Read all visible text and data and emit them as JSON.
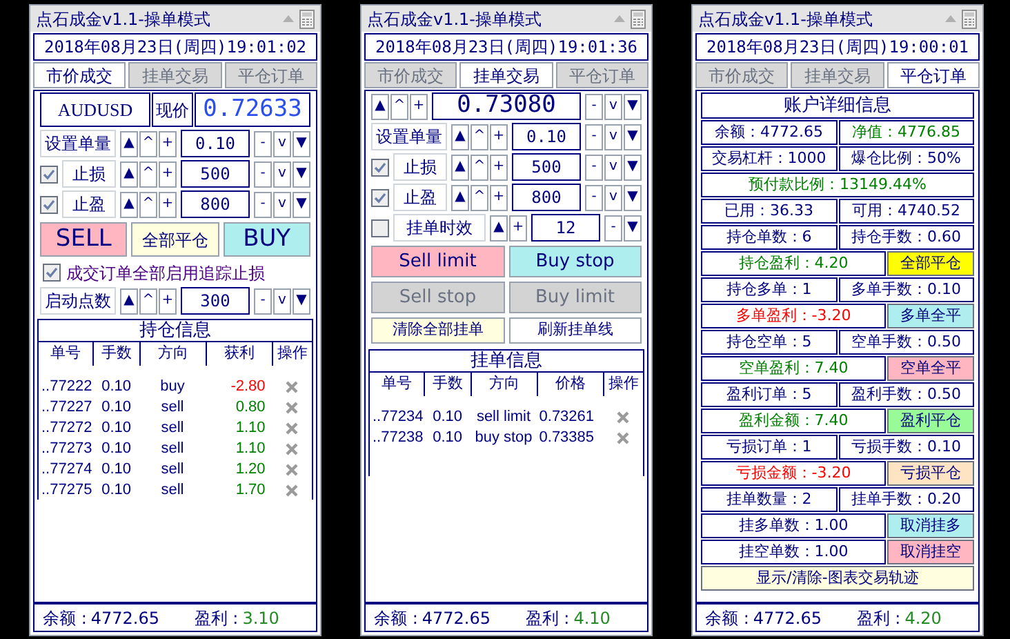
{
  "panels": [
    {
      "title": "点石成金v1.1-操单模式",
      "datetime": "2018年08月23日(周四)19:01:02",
      "tabs": [
        {
          "label": "市价成交",
          "selected": true
        },
        {
          "label": "挂单交易",
          "selected": false
        },
        {
          "label": "平仓订单",
          "selected": false
        }
      ],
      "sections": [
        {
          "kind": "quote",
          "symbol": "AUDUSD",
          "label": "现价",
          "price": "0.72633"
        },
        {
          "kind": "stepper",
          "label": "设置单量",
          "value": "0.10",
          "up": [
            "▲",
            "^",
            "+"
          ],
          "down": [
            "-",
            "v",
            "▼"
          ]
        },
        {
          "kind": "stepper",
          "label": "止损",
          "checked": true,
          "value": "500",
          "up": [
            "▲",
            "^",
            "+"
          ],
          "down": [
            "-",
            "v",
            "▼"
          ]
        },
        {
          "kind": "stepper",
          "label": "止盈",
          "checked": true,
          "value": "800",
          "up": [
            "▲",
            "^",
            "+"
          ],
          "down": [
            "-",
            "v",
            "▼"
          ]
        },
        {
          "kind": "buttons",
          "items": [
            {
              "label": "SELL",
              "color": "#ffb6c1",
              "disabled": false
            },
            {
              "label": "全部平仓",
              "color": "#ffffe0",
              "disabled": false
            },
            {
              "label": "BUY",
              "color": "#afeeee",
              "disabled": false
            }
          ]
        },
        {
          "kind": "checkbox",
          "label": "成交订单全部启用追踪止损",
          "checked": true
        },
        {
          "kind": "stepper",
          "label": "启动点数",
          "value": "300",
          "up": [
            "▲",
            "^",
            "+"
          ],
          "down": [
            "-",
            "v",
            "▼"
          ]
        },
        {
          "kind": "table",
          "title": "持仓信息",
          "columns": [
            "单号",
            "手数",
            "方向",
            "获利",
            "操作"
          ],
          "rows": [
            {
              "cells": [
                "..77222",
                "0.10",
                "buy",
                "-2.80"
              ],
              "color": "#ff0000"
            },
            {
              "cells": [
                "..77227",
                "0.10",
                "sell",
                "0.80"
              ],
              "color": "#008000"
            },
            {
              "cells": [
                "..77272",
                "0.10",
                "sell",
                "1.10"
              ],
              "color": "#008000"
            },
            {
              "cells": [
                "..77273",
                "0.10",
                "sell",
                "1.10"
              ],
              "color": "#008000"
            },
            {
              "cells": [
                "..77274",
                "0.10",
                "sell",
                "1.20"
              ],
              "color": "#008000"
            },
            {
              "cells": [
                "..77275",
                "0.10",
                "sell",
                "1.70"
              ],
              "color": "#008000"
            }
          ]
        }
      ],
      "footer": {
        "balance_label": "余额 :",
        "balance": "4772.65",
        "profit_label": "盈利 :",
        "profit": "3.10"
      }
    },
    {
      "title": "点石成金v1.1-操单模式",
      "datetime": "2018年08月23日(周四)19:01:36",
      "tabs": [
        {
          "label": "市价成交",
          "selected": false
        },
        {
          "label": "挂单交易",
          "selected": true
        },
        {
          "label": "平仓订单",
          "selected": false
        }
      ],
      "sections": [
        {
          "kind": "stepper",
          "value": "0.73080",
          "up": [
            "▲",
            "^",
            "+"
          ],
          "down": [
            "-",
            "v",
            "▼"
          ]
        },
        {
          "kind": "stepper",
          "label": "设置单量",
          "value": "0.10",
          "up": [
            "▲",
            "^",
            "+"
          ],
          "down": [
            "-",
            "v",
            "▼"
          ]
        },
        {
          "kind": "stepper",
          "label": "止损",
          "checked": true,
          "value": "500",
          "up": [
            "▲",
            "^",
            "+"
          ],
          "down": [
            "-",
            "v",
            "▼"
          ]
        },
        {
          "kind": "stepper",
          "label": "止盈",
          "checked": true,
          "value": "800",
          "up": [
            "▲",
            "^",
            "+"
          ],
          "down": [
            "-",
            "v",
            "▼"
          ]
        },
        {
          "kind": "stepper",
          "label": "挂单时效",
          "checked": false,
          "value": "12",
          "up": [
            "▲",
            "+"
          ],
          "down": [
            "-",
            "▼"
          ]
        },
        {
          "kind": "buttons",
          "items": [
            {
              "label": "Sell limit",
              "color": "#ffb6c1",
              "disabled": false
            },
            {
              "label": "Buy stop",
              "color": "#afeeee",
              "disabled": false
            },
            {
              "label": "Sell stop",
              "color": "#d3d3d3",
              "disabled": true
            },
            {
              "label": "Buy limit",
              "color": "#d3d3d3",
              "disabled": true
            },
            {
              "label": "清除全部挂单",
              "color": "#ffffe0",
              "disabled": false
            },
            {
              "label": "刷新挂单线",
              "color": "#ffffff",
              "disabled": false
            }
          ]
        },
        {
          "kind": "table",
          "title": "挂单信息",
          "columns": [
            "单号",
            "手数",
            "方向",
            "价格",
            "操作"
          ],
          "rows": [
            {
              "cells": [
                "..77234",
                "0.10",
                "sell limit",
                "0.73261"
              ]
            },
            {
              "cells": [
                "..77238",
                "0.10",
                "buy stop",
                "0.73385"
              ]
            }
          ]
        }
      ],
      "footer": {
        "balance_label": "余额 :",
        "balance": "4772.65",
        "profit_label": "盈利 :",
        "profit": "4.10"
      }
    },
    {
      "title": "点石成金v1.1-操单模式",
      "datetime": "2018年08月23日(周四)19:00:01",
      "tabs": [
        {
          "label": "市价成交",
          "selected": false
        },
        {
          "label": "挂单交易",
          "selected": false
        },
        {
          "label": "平仓订单",
          "selected": true
        }
      ],
      "sections": [
        {
          "kind": "account",
          "title": "账户详细信息",
          "rows": [
            [
              {
                "kind": "text",
                "text": "余额：4772.65",
                "color": "#000080"
              },
              {
                "kind": "text",
                "text": "净值：4776.85",
                "color": "#008000"
              }
            ],
            [
              {
                "kind": "text",
                "text": "交易杠杆：1000",
                "color": "#000080"
              },
              {
                "kind": "text",
                "text": "爆仓比例：50%",
                "color": "#000080"
              }
            ],
            [
              {
                "kind": "text",
                "text": "预付款比例：13149.44%",
                "color": "#008000"
              }
            ],
            [
              {
                "kind": "text",
                "text": "已用：36.33",
                "color": "#000080"
              },
              {
                "kind": "text",
                "text": "可用：4740.52",
                "color": "#000080"
              }
            ],
            [
              {
                "kind": "text",
                "text": "持仓单数：6",
                "color": "#000080"
              },
              {
                "kind": "text",
                "text": "持仓手数：0.60",
                "color": "#000080"
              }
            ],
            [
              {
                "kind": "text",
                "text": "持仓盈利：4.20",
                "color": "#008000"
              },
              {
                "kind": "button",
                "text": "全部平仓",
                "color": "#ffff00"
              }
            ],
            [
              {
                "kind": "text",
                "text": "持仓多单：1",
                "color": "#000080"
              },
              {
                "kind": "text",
                "text": "多单手数：0.10",
                "color": "#000080"
              }
            ],
            [
              {
                "kind": "text",
                "text": "多单盈利：-3.20",
                "color": "#ff0000"
              },
              {
                "kind": "button",
                "text": "多单全平",
                "color": "#afeeee"
              }
            ],
            [
              {
                "kind": "text",
                "text": "持仓空单：5",
                "color": "#000080"
              },
              {
                "kind": "text",
                "text": "空单手数：0.50",
                "color": "#000080"
              }
            ],
            [
              {
                "kind": "text",
                "text": "空单盈利：7.40",
                "color": "#008000"
              },
              {
                "kind": "button",
                "text": "空单全平",
                "color": "#ffb6c1"
              }
            ],
            [
              {
                "kind": "text",
                "text": "盈利订单：5",
                "color": "#000080"
              },
              {
                "kind": "text",
                "text": "盈利手数：0.50",
                "color": "#000080"
              }
            ],
            [
              {
                "kind": "text",
                "text": "盈利金额：7.40",
                "color": "#008000"
              },
              {
                "kind": "button",
                "text": "盈利平仓",
                "color": "#98fb98"
              }
            ],
            [
              {
                "kind": "text",
                "text": "亏损订单：1",
                "color": "#000080"
              },
              {
                "kind": "text",
                "text": "亏损手数：0.10",
                "color": "#000080"
              }
            ],
            [
              {
                "kind": "text",
                "text": "亏损金额：-3.20",
                "color": "#ff0000"
              },
              {
                "kind": "button",
                "text": "亏损平仓",
                "color": "#ffe4c4"
              }
            ],
            [
              {
                "kind": "text",
                "text": "挂单数量：2",
                "color": "#000080"
              },
              {
                "kind": "text",
                "text": "挂单手数：0.20",
                "color": "#000080"
              }
            ],
            [
              {
                "kind": "text",
                "text": "挂多单数：1.00",
                "color": "#000080"
              },
              {
                "kind": "button",
                "text": "取消挂多",
                "color": "#afeeee"
              }
            ],
            [
              {
                "kind": "text",
                "text": "挂空单数：1.00",
                "color": "#000080"
              },
              {
                "kind": "button",
                "text": "取消挂空",
                "color": "#ffb6c1"
              }
            ],
            [
              {
                "kind": "button",
                "text": "显示/清除-图表交易轨迹",
                "color": "#ffffe0"
              }
            ]
          ]
        }
      ],
      "footer": {
        "balance_label": "余额 :",
        "balance": "4772.65",
        "profit_label": "盈利 :",
        "profit": "4.20"
      }
    }
  ]
}
